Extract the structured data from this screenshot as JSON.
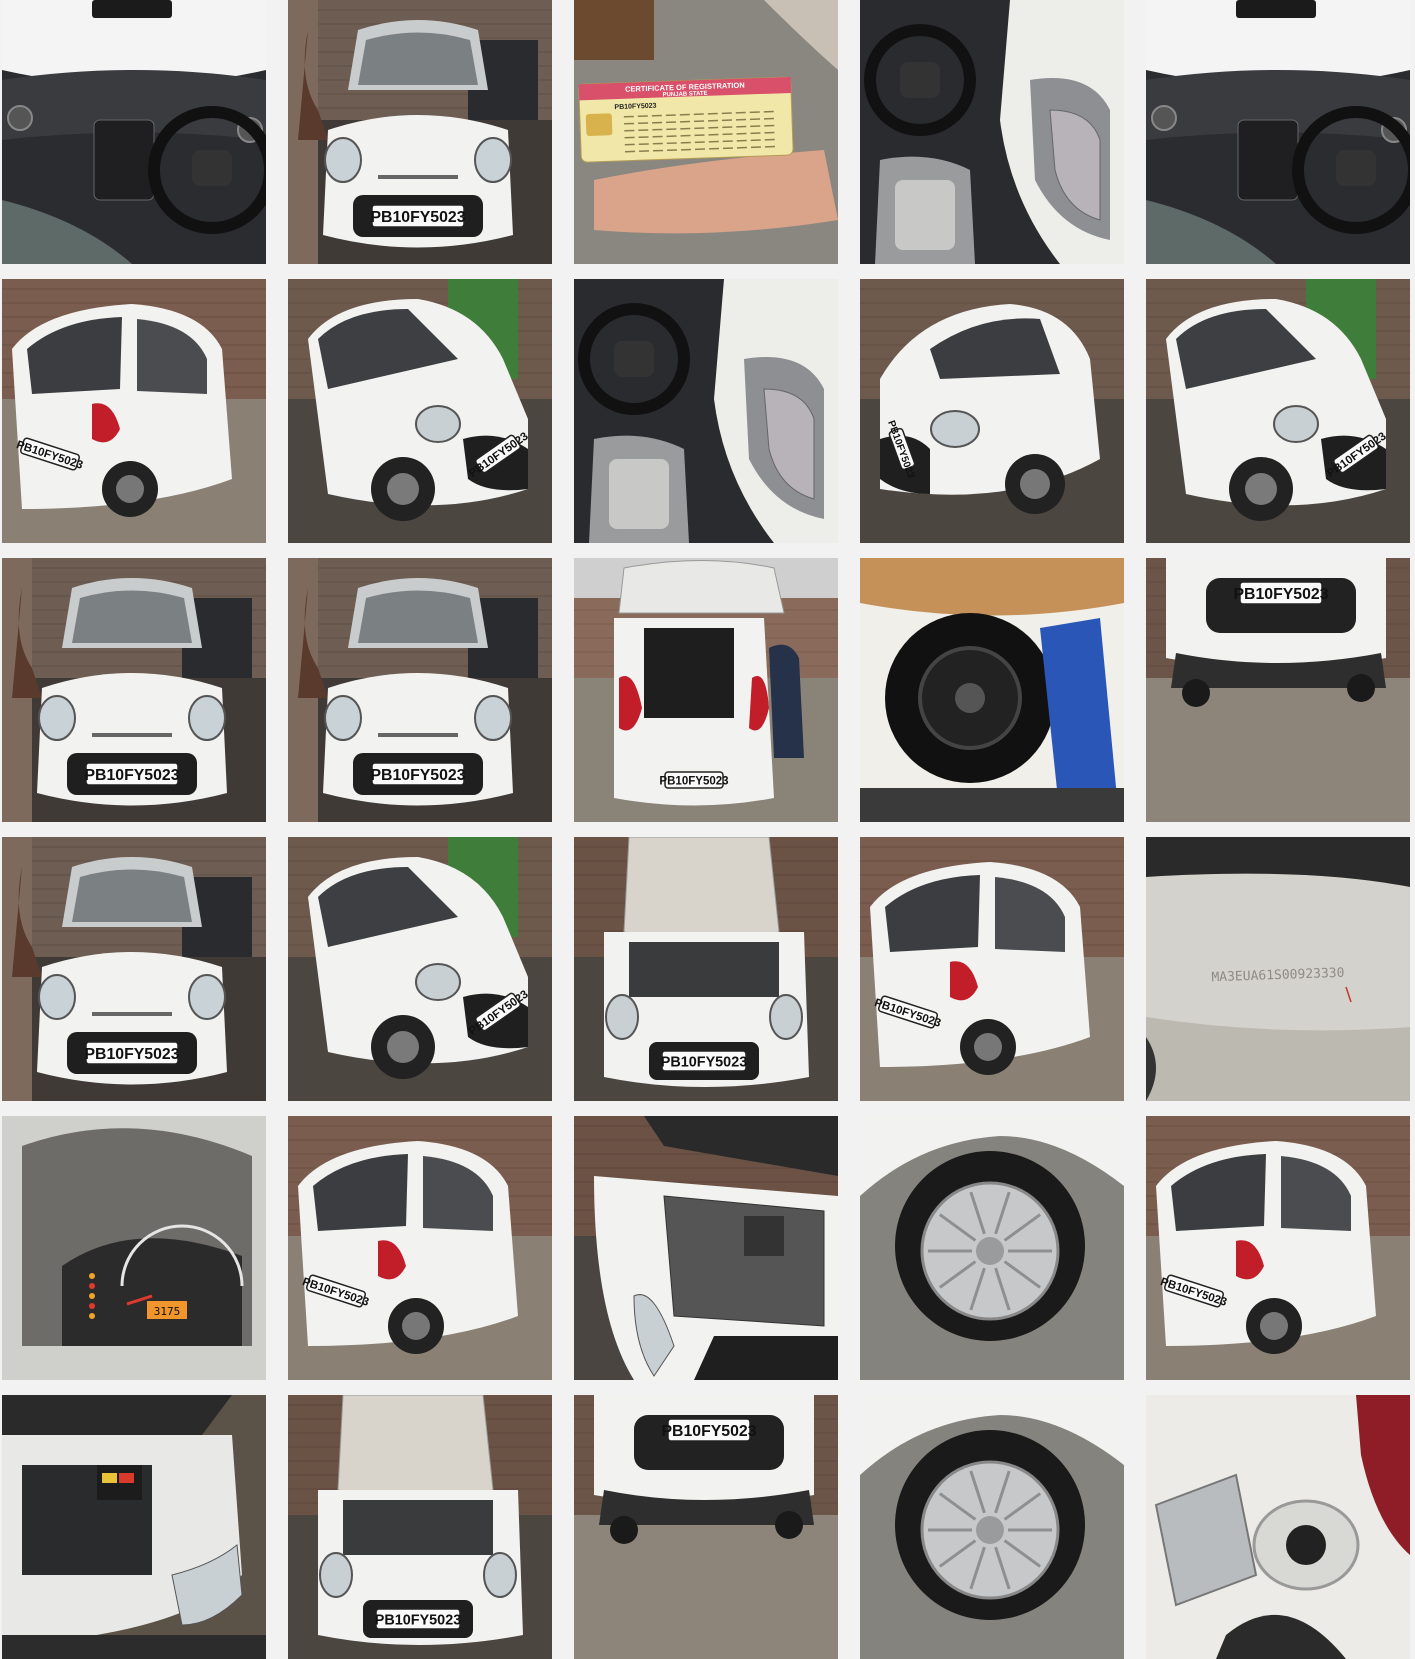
{
  "gallery": {
    "plate": "PB10FY5023",
    "plate_spaced": "PB 10 FY 5023",
    "certificate_title": "CERTIFICATE OF REGISTRATION",
    "certificate_state": "PUNJAB STATE",
    "chassis_number": "MA3EUA61S00923330",
    "odometer": "3175"
  },
  "colors": {
    "car_white": "#f2f2f0",
    "asphalt": "#8a8378",
    "brick": "#7a5a4a",
    "dark_interior": "#2c2d30",
    "tail_red": "#c21e2a",
    "door_green": "#3f7d3a"
  },
  "tiles": [
    {
      "kind": "interior-dashboard"
    },
    {
      "kind": "front-view"
    },
    {
      "kind": "registration-certificate"
    },
    {
      "kind": "interior-driver-door"
    },
    {
      "kind": "interior-dashboard"
    },
    {
      "kind": "rear-angle-view"
    },
    {
      "kind": "front-angle-view"
    },
    {
      "kind": "interior-driver-door"
    },
    {
      "kind": "front-angle-left-view"
    },
    {
      "kind": "front-angle-view"
    },
    {
      "kind": "front-view"
    },
    {
      "kind": "front-view"
    },
    {
      "kind": "rear-open-boot"
    },
    {
      "kind": "spare-wheel"
    },
    {
      "kind": "front-bumper-low"
    },
    {
      "kind": "front-view"
    },
    {
      "kind": "front-angle-view"
    },
    {
      "kind": "engine-bay-front"
    },
    {
      "kind": "rear-angle-view"
    },
    {
      "kind": "chassis-number"
    },
    {
      "kind": "odometer"
    },
    {
      "kind": "rear-angle-view"
    },
    {
      "kind": "engine-bay-side"
    },
    {
      "kind": "wheel-closeup"
    },
    {
      "kind": "rear-angle-view"
    },
    {
      "kind": "engine-bay-battery"
    },
    {
      "kind": "engine-bay-front"
    },
    {
      "kind": "front-bumper-low"
    },
    {
      "kind": "wheel-closeup"
    },
    {
      "kind": "fuel-cap"
    }
  ]
}
